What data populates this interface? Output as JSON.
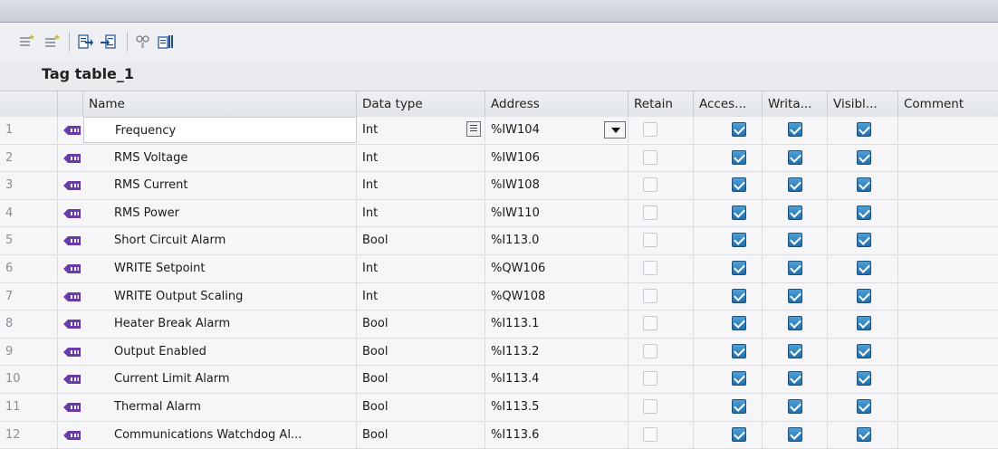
{
  "table": {
    "title": "Tag table_1",
    "columns": {
      "name": "Name",
      "data_type": "Data type",
      "address": "Address",
      "retain": "Retain",
      "accessible": "Acces...",
      "writable": "Writa...",
      "visible": "Visibl...",
      "comment": "Comment"
    },
    "rows": [
      {
        "num": "1",
        "name": "Frequency",
        "data_type": "Int",
        "address": "%IW104",
        "retain": false,
        "accessible": true,
        "writable": true,
        "visible": true,
        "comment": ""
      },
      {
        "num": "2",
        "name": "RMS Voltage",
        "data_type": "Int",
        "address": "%IW106",
        "retain": false,
        "accessible": true,
        "writable": true,
        "visible": true,
        "comment": ""
      },
      {
        "num": "3",
        "name": "RMS Current",
        "data_type": "Int",
        "address": "%IW108",
        "retain": false,
        "accessible": true,
        "writable": true,
        "visible": true,
        "comment": ""
      },
      {
        "num": "4",
        "name": "RMS Power",
        "data_type": "Int",
        "address": "%IW110",
        "retain": false,
        "accessible": true,
        "writable": true,
        "visible": true,
        "comment": ""
      },
      {
        "num": "5",
        "name": "Short Circuit Alarm",
        "data_type": "Bool",
        "address": "%I113.0",
        "retain": false,
        "accessible": true,
        "writable": true,
        "visible": true,
        "comment": ""
      },
      {
        "num": "6",
        "name": "WRITE Setpoint",
        "data_type": "Int",
        "address": "%QW106",
        "retain": false,
        "accessible": true,
        "writable": true,
        "visible": true,
        "comment": ""
      },
      {
        "num": "7",
        "name": "WRITE Output Scaling",
        "data_type": "Int",
        "address": "%QW108",
        "retain": false,
        "accessible": true,
        "writable": true,
        "visible": true,
        "comment": ""
      },
      {
        "num": "8",
        "name": "Heater Break Alarm",
        "data_type": "Bool",
        "address": "%I113.1",
        "retain": false,
        "accessible": true,
        "writable": true,
        "visible": true,
        "comment": ""
      },
      {
        "num": "9",
        "name": "Output Enabled",
        "data_type": "Bool",
        "address": "%I113.2",
        "retain": false,
        "accessible": true,
        "writable": true,
        "visible": true,
        "comment": ""
      },
      {
        "num": "10",
        "name": "Current Limit Alarm",
        "data_type": "Bool",
        "address": "%I113.4",
        "retain": false,
        "accessible": true,
        "writable": true,
        "visible": true,
        "comment": ""
      },
      {
        "num": "11",
        "name": "Thermal Alarm",
        "data_type": "Bool",
        "address": "%I113.5",
        "retain": false,
        "accessible": true,
        "writable": true,
        "visible": true,
        "comment": ""
      },
      {
        "num": "12",
        "name": "Communications Watchdog Al...",
        "data_type": "Bool",
        "address": "%I113.6",
        "retain": false,
        "accessible": true,
        "writable": true,
        "visible": true,
        "comment": ""
      }
    ]
  },
  "toolbar": {
    "buttons": [
      {
        "icon": "insert-row-icon"
      },
      {
        "icon": "add-row-icon"
      },
      {
        "icon": "export-icon"
      },
      {
        "icon": "import-icon"
      },
      {
        "icon": "monitor-all-icon"
      },
      {
        "icon": "show-settings-icon"
      }
    ]
  },
  "colors": {
    "checkbox_checked": "#1f6fae",
    "tag_icon": "#6a3aa8",
    "header_bg": "#e1e4e9"
  }
}
